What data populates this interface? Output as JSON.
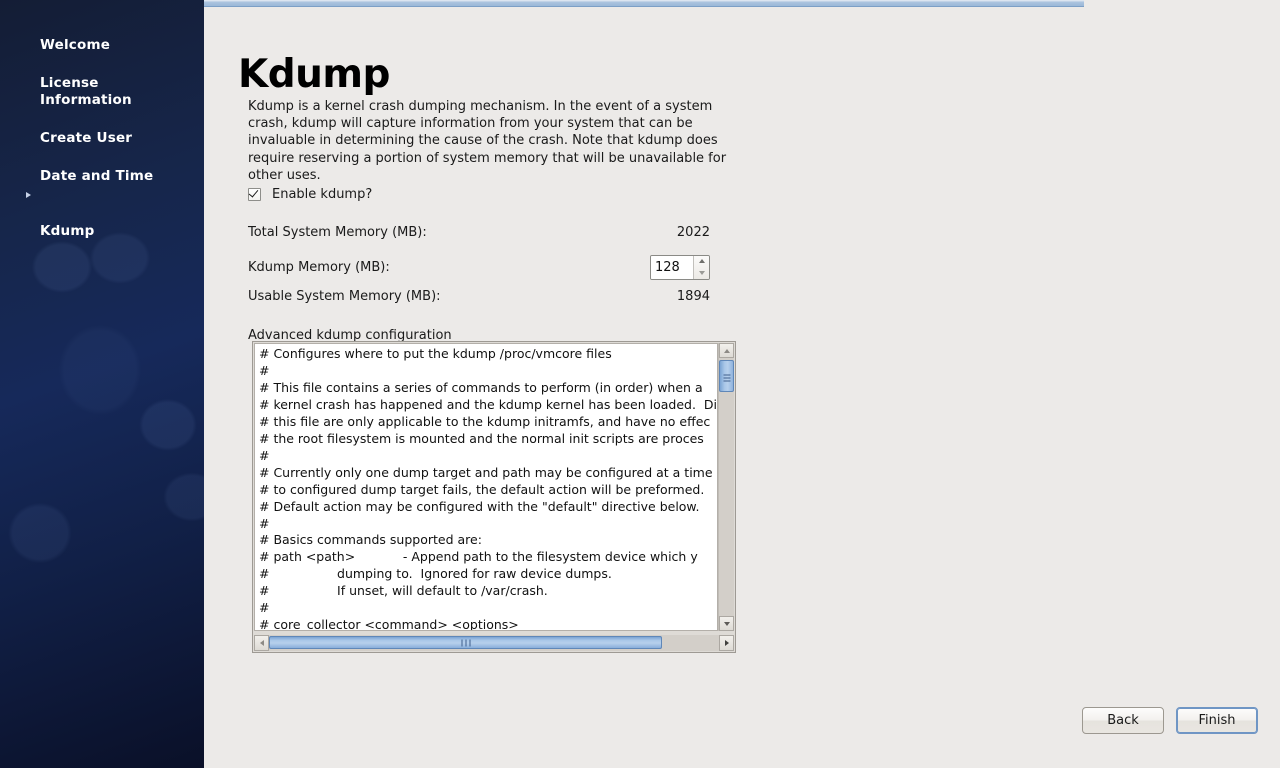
{
  "sidebar": {
    "items": [
      {
        "label": "Welcome",
        "current": false
      },
      {
        "label": "License\nInformation",
        "current": false
      },
      {
        "label": "Create User",
        "current": false
      },
      {
        "label": "Date and Time",
        "current": false
      },
      {
        "label": "Kdump",
        "current": true
      }
    ]
  },
  "page": {
    "title": "Kdump",
    "intro": "Kdump is a kernel crash dumping mechanism. In the event of a system crash, kdump will capture information from your system that can be invaluable in determining the cause of the crash. Note that kdump does require reserving a portion of system memory that will be unavailable for other uses."
  },
  "form": {
    "enable_label": "Enable kdump?",
    "enable_checked": "checked",
    "total_memory_label": "Total System Memory (MB):",
    "total_memory_value": "2022",
    "kdump_memory_label": "Kdump Memory (MB):",
    "kdump_memory_value": "128",
    "usable_memory_label": "Usable System Memory (MB):",
    "usable_memory_value": "1894",
    "advanced_label": "Advanced kdump configuration"
  },
  "editor": {
    "content": "# Configures where to put the kdump /proc/vmcore files\n#\n# This file contains a series of commands to perform (in order) when a\n# kernel crash has happened and the kdump kernel has been loaded.  Di\n# this file are only applicable to the kdump initramfs, and have no effec\n# the root filesystem is mounted and the normal init scripts are proces\n#\n# Currently only one dump target and path may be configured at a time\n# to configured dump target fails, the default action will be preformed.\n# Default action may be configured with the \"default\" directive below.\n#\n# Basics commands supported are:\n# path <path>            - Append path to the filesystem device which y\n#                 dumping to.  Ignored for raw device dumps.\n#                 If unset, will default to /var/crash.\n#\n# core_collector <command> <options>"
  },
  "footer": {
    "back_label": "Back",
    "finish_label": "Finish"
  },
  "colors": {
    "sidebar_top": "#141d35",
    "sidebar_mid": "#16295a",
    "sidebar_bottom": "#0a1028",
    "content_bg": "#eceae8",
    "accent_blue": "#9bb8d8",
    "scroll_thumb": "#a9c7e8",
    "focus_border": "#6e95c5"
  }
}
